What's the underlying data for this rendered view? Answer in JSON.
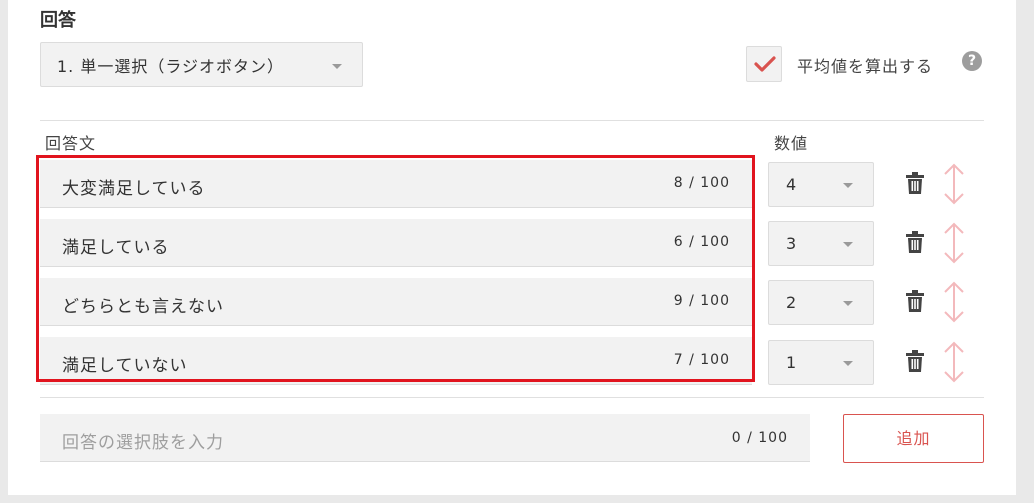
{
  "section_title": "回答",
  "answer_type": {
    "selected": "1. 単一選択（ラジオボタン）"
  },
  "average": {
    "label": "平均値を算出する",
    "checked": true,
    "help": "?"
  },
  "columns": {
    "answer_text": "回答文",
    "value": "数値"
  },
  "answers": [
    {
      "text": "大変満足している",
      "count": "8 / 100",
      "value": "4"
    },
    {
      "text": "満足している",
      "count": "6 / 100",
      "value": "3"
    },
    {
      "text": "どちらとも言えない",
      "count": "9 / 100",
      "value": "2"
    },
    {
      "text": "満足していない",
      "count": "7 / 100",
      "value": "1"
    }
  ],
  "new_answer": {
    "placeholder": "回答の選択肢を入力",
    "count": "0 / 100"
  },
  "add_button": "追加",
  "colors": {
    "accent": "#d9534f",
    "highlight": "#e1141e"
  }
}
